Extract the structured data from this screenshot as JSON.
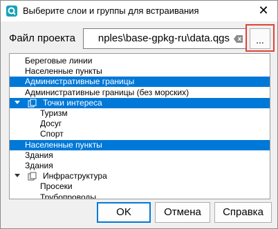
{
  "window": {
    "title": "Выберите слои и группы для встраивания",
    "close_glyph": "✕"
  },
  "file": {
    "label": "Файл проекта",
    "path": "nples\\base-gpkg-ru\\data.qgs",
    "browse_label": "..."
  },
  "tree": {
    "items": [
      {
        "label": "Береговые линии",
        "selected": false
      },
      {
        "label": "Населенные пункты",
        "selected": false
      },
      {
        "label": "Административные границы",
        "selected": true
      },
      {
        "label": "Административные границы (без морских)",
        "selected": false
      },
      {
        "label": "Точки интереса",
        "selected": true,
        "group": true,
        "expanded": true
      },
      {
        "label": "Туризм",
        "selected": false,
        "child": true
      },
      {
        "label": "Досуг",
        "selected": false,
        "child": true
      },
      {
        "label": "Спорт",
        "selected": false,
        "child": true
      },
      {
        "label": "Населенные пункты",
        "selected": true
      },
      {
        "label": "Здания",
        "selected": false
      },
      {
        "label": "Здания",
        "selected": false
      },
      {
        "label": "Инфраструктура",
        "selected": false,
        "group": true,
        "expanded": true
      },
      {
        "label": "Просеки",
        "selected": false,
        "child": true
      },
      {
        "label": "Трубопроводы",
        "selected": false,
        "child": true
      }
    ]
  },
  "buttons": {
    "ok": "OK",
    "cancel": "Отмена",
    "help": "Справка"
  },
  "colors": {
    "selection": "#0078d7",
    "highlight": "#e0413a",
    "app_icon": "#17a2b8"
  }
}
